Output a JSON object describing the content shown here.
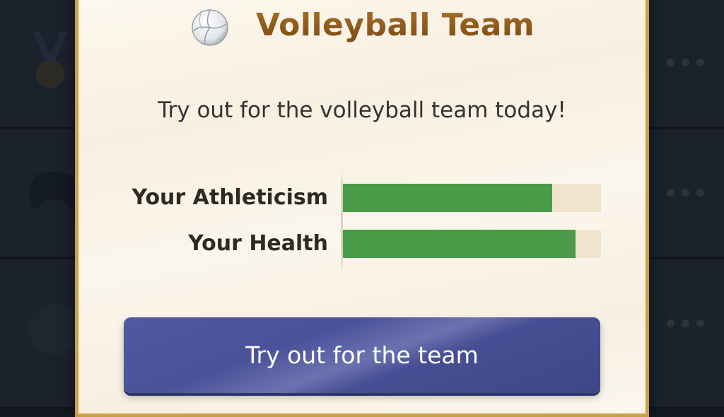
{
  "modal": {
    "title": "Volleyball Team",
    "title_icon": "volleyball-icon",
    "description": "Try out for the volleyball team today!",
    "stats": [
      {
        "label": "Your Athleticism",
        "value": 0.81
      },
      {
        "label": "Your Health",
        "value": 0.9
      }
    ],
    "action_label": "Try out for the team"
  },
  "colors": {
    "bar_fill": "#4a9c48",
    "bar_track": "#f1e4cf",
    "title": "#8a5a1e",
    "button": "#4a5299",
    "border": "#c9a04a"
  },
  "background": {
    "row_icons": [
      "medal-icon",
      "gamepad-icon",
      "circle-icon"
    ]
  }
}
